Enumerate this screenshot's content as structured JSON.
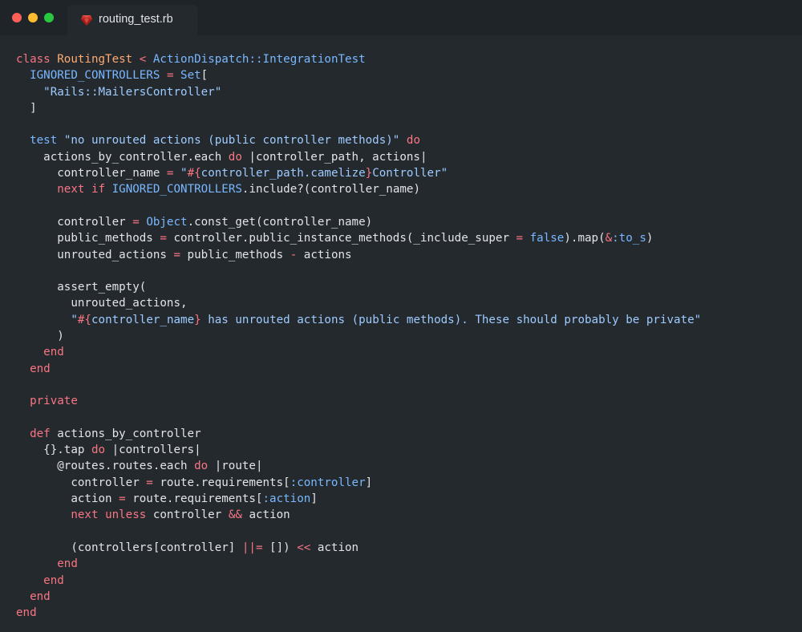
{
  "window": {
    "tab": {
      "label": "routing_test.rb",
      "icon": "ruby-file-icon"
    }
  },
  "colors": {
    "background": "#24292e",
    "titlebar": "#1f2428",
    "keyword": "#f97583",
    "class_name": "#ffab70",
    "constant": "#79b8ff",
    "string": "#9ecbff",
    "plain": "#e1e4e8"
  },
  "code": {
    "lines": [
      [
        [
          "kw",
          "class"
        ],
        [
          "plain",
          " "
        ],
        [
          "cls",
          "RoutingTest"
        ],
        [
          "plain",
          " "
        ],
        [
          "kw",
          "<"
        ],
        [
          "plain",
          " "
        ],
        [
          "const",
          "ActionDispatch::IntegrationTest"
        ]
      ],
      [
        [
          "plain",
          "  "
        ],
        [
          "const",
          "IGNORED_CONTROLLERS"
        ],
        [
          "plain",
          " "
        ],
        [
          "kw",
          "="
        ],
        [
          "plain",
          " "
        ],
        [
          "const",
          "Set"
        ],
        [
          "plain",
          "["
        ]
      ],
      [
        [
          "plain",
          "    "
        ],
        [
          "str",
          "\"Rails::MailersController\""
        ]
      ],
      [
        [
          "plain",
          "  ]"
        ]
      ],
      [],
      [
        [
          "plain",
          "  "
        ],
        [
          "const",
          "test"
        ],
        [
          "plain",
          " "
        ],
        [
          "str",
          "\"no unrouted actions (public controller methods)\""
        ],
        [
          "plain",
          " "
        ],
        [
          "kw",
          "do"
        ]
      ],
      [
        [
          "plain",
          "    actions_by_controller.each "
        ],
        [
          "kw",
          "do"
        ],
        [
          "plain",
          " |controller_path, actions|"
        ]
      ],
      [
        [
          "plain",
          "      controller_name "
        ],
        [
          "kw",
          "="
        ],
        [
          "plain",
          " "
        ],
        [
          "str",
          "\""
        ],
        [
          "kw",
          "#{"
        ],
        [
          "str",
          "controller_path.camelize"
        ],
        [
          "kw",
          "}"
        ],
        [
          "str",
          "Controller\""
        ]
      ],
      [
        [
          "plain",
          "      "
        ],
        [
          "kw",
          "next"
        ],
        [
          "plain",
          " "
        ],
        [
          "kw",
          "if"
        ],
        [
          "plain",
          " "
        ],
        [
          "const",
          "IGNORED_CONTROLLERS"
        ],
        [
          "plain",
          ".include?(controller_name)"
        ]
      ],
      [],
      [
        [
          "plain",
          "      controller "
        ],
        [
          "kw",
          "="
        ],
        [
          "plain",
          " "
        ],
        [
          "const",
          "Object"
        ],
        [
          "plain",
          ".const_get(controller_name)"
        ]
      ],
      [
        [
          "plain",
          "      public_methods "
        ],
        [
          "kw",
          "="
        ],
        [
          "plain",
          " controller.public_instance_methods(_include_super "
        ],
        [
          "kw",
          "="
        ],
        [
          "plain",
          " "
        ],
        [
          "const",
          "false"
        ],
        [
          "plain",
          ").map("
        ],
        [
          "kw",
          "&"
        ],
        [
          "const",
          ":to_s"
        ],
        [
          "plain",
          ")"
        ]
      ],
      [
        [
          "plain",
          "      unrouted_actions "
        ],
        [
          "kw",
          "="
        ],
        [
          "plain",
          " public_methods "
        ],
        [
          "kw",
          "-"
        ],
        [
          "plain",
          " actions"
        ]
      ],
      [],
      [
        [
          "plain",
          "      assert_empty("
        ]
      ],
      [
        [
          "plain",
          "        unrouted_actions,"
        ]
      ],
      [
        [
          "plain",
          "        "
        ],
        [
          "str",
          "\""
        ],
        [
          "kw",
          "#{"
        ],
        [
          "str",
          "controller_name"
        ],
        [
          "kw",
          "}"
        ],
        [
          "str",
          " has unrouted actions (public methods). These should probably be private\""
        ]
      ],
      [
        [
          "plain",
          "      )"
        ]
      ],
      [
        [
          "plain",
          "    "
        ],
        [
          "kw",
          "end"
        ]
      ],
      [
        [
          "plain",
          "  "
        ],
        [
          "kw",
          "end"
        ]
      ],
      [],
      [
        [
          "plain",
          "  "
        ],
        [
          "kw",
          "private"
        ]
      ],
      [],
      [
        [
          "plain",
          "  "
        ],
        [
          "kw",
          "def"
        ],
        [
          "plain",
          " actions_by_controller"
        ]
      ],
      [
        [
          "plain",
          "    {}.tap "
        ],
        [
          "kw",
          "do"
        ],
        [
          "plain",
          " |controllers|"
        ]
      ],
      [
        [
          "plain",
          "      @routes.routes.each "
        ],
        [
          "kw",
          "do"
        ],
        [
          "plain",
          " |route|"
        ]
      ],
      [
        [
          "plain",
          "        controller "
        ],
        [
          "kw",
          "="
        ],
        [
          "plain",
          " route.requirements["
        ],
        [
          "const",
          ":controller"
        ],
        [
          "plain",
          "]"
        ]
      ],
      [
        [
          "plain",
          "        action "
        ],
        [
          "kw",
          "="
        ],
        [
          "plain",
          " route.requirements["
        ],
        [
          "const",
          ":action"
        ],
        [
          "plain",
          "]"
        ]
      ],
      [
        [
          "plain",
          "        "
        ],
        [
          "kw",
          "next"
        ],
        [
          "plain",
          " "
        ],
        [
          "kw",
          "unless"
        ],
        [
          "plain",
          " controller "
        ],
        [
          "kw",
          "&&"
        ],
        [
          "plain",
          " action"
        ]
      ],
      [],
      [
        [
          "plain",
          "        (controllers[controller] "
        ],
        [
          "kw",
          "||="
        ],
        [
          "plain",
          " []) "
        ],
        [
          "kw",
          "<<"
        ],
        [
          "plain",
          " action"
        ]
      ],
      [
        [
          "plain",
          "      "
        ],
        [
          "kw",
          "end"
        ]
      ],
      [
        [
          "plain",
          "    "
        ],
        [
          "kw",
          "end"
        ]
      ],
      [
        [
          "plain",
          "  "
        ],
        [
          "kw",
          "end"
        ]
      ],
      [
        [
          "kw",
          "end"
        ]
      ]
    ]
  }
}
